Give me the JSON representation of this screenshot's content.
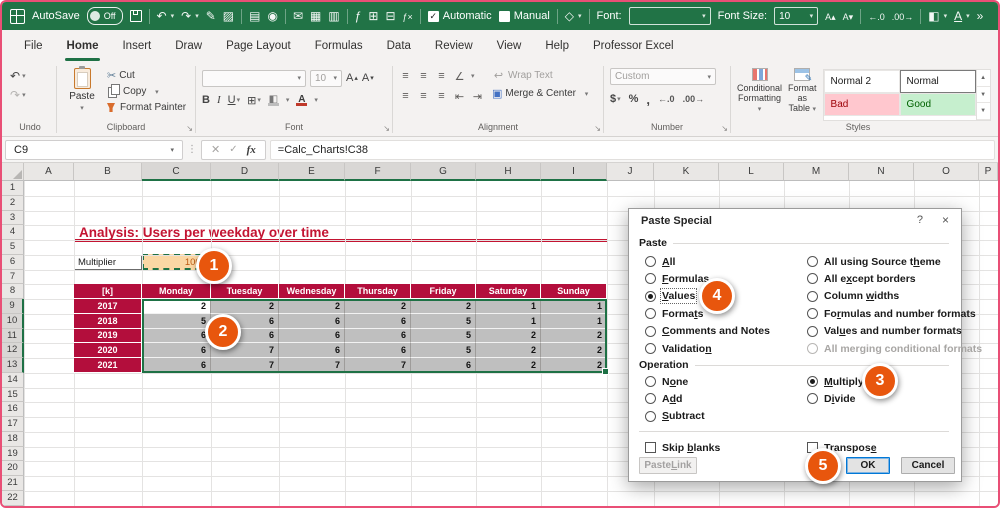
{
  "titlebar": {
    "autosave_label": "AutoSave",
    "autosave_state": "Off",
    "calc_automatic": "Automatic",
    "calc_manual": "Manual",
    "font_label": "Font:",
    "font_size_label": "Font Size:",
    "font_size_value": "10"
  },
  "tabs": [
    {
      "label": "File"
    },
    {
      "label": "Home",
      "active": true
    },
    {
      "label": "Insert"
    },
    {
      "label": "Draw"
    },
    {
      "label": "Page Layout"
    },
    {
      "label": "Formulas"
    },
    {
      "label": "Data"
    },
    {
      "label": "Review"
    },
    {
      "label": "View"
    },
    {
      "label": "Help"
    },
    {
      "label": "Professor Excel"
    }
  ],
  "ribbon": {
    "undo_label": "Undo",
    "clipboard": {
      "label": "Clipboard",
      "paste": "Paste",
      "cut": "Cut",
      "copy": "Copy",
      "format_painter": "Format Painter"
    },
    "font": {
      "label": "Font",
      "size": "10",
      "bold": "B",
      "italic": "I",
      "underline": "U"
    },
    "alignment": {
      "label": "Alignment",
      "wrap": "Wrap Text",
      "merge": "Merge & Center"
    },
    "number": {
      "label": "Number",
      "format": "Custom",
      "dollar": "$",
      "percent": "%",
      "comma": ","
    },
    "styles": {
      "label": "Styles",
      "cf_line1": "Conditional",
      "cf_line2": "Formatting",
      "fat_line1": "Format as",
      "fat_line2": "Table",
      "gallery": [
        {
          "name": "Normal 2",
          "bg": "#FFFFFF",
          "fg": "#1a1a1a"
        },
        {
          "name": "Normal",
          "bg": "#FFFFFF",
          "fg": "#1a1a1a",
          "selected": true
        },
        {
          "name": "Bad",
          "bg": "#FFC7CE",
          "fg": "#9C0006"
        },
        {
          "name": "Good",
          "bg": "#C6EFCE",
          "fg": "#006100"
        }
      ]
    }
  },
  "formula_bar": {
    "cell_ref": "C9",
    "formula": "=Calc_Charts!C38"
  },
  "sheet": {
    "columns": [
      "A",
      "B",
      "C",
      "D",
      "E",
      "F",
      "G",
      "H",
      "I",
      "J",
      "K",
      "L",
      "M",
      "N",
      "O",
      "P"
    ],
    "selected_columns": [
      "C",
      "D",
      "E",
      "F",
      "G",
      "H",
      "I"
    ],
    "row_count": 22,
    "selected_rows": [
      9,
      10,
      11,
      12,
      13
    ],
    "title": "Analysis: Users per weekday over time",
    "multiplier_label": "Multiplier",
    "multiplier_value": "1000",
    "table": {
      "corner": "[k]",
      "days": [
        "Monday",
        "Tuesday",
        "Wednesday",
        "Thursday",
        "Friday",
        "Saturday",
        "Sunday"
      ],
      "rows": [
        {
          "year": "2017",
          "values": [
            2,
            2,
            2,
            2,
            2,
            1,
            1
          ]
        },
        {
          "year": "2018",
          "values": [
            5,
            6,
            6,
            6,
            5,
            1,
            1
          ]
        },
        {
          "year": "2019",
          "values": [
            6,
            6,
            6,
            6,
            5,
            2,
            2
          ]
        },
        {
          "year": "2020",
          "values": [
            6,
            7,
            6,
            6,
            5,
            2,
            2
          ]
        },
        {
          "year": "2021",
          "values": [
            6,
            7,
            7,
            7,
            6,
            2,
            2
          ]
        }
      ]
    }
  },
  "dialog": {
    "title": "Paste Special",
    "help": "?",
    "close": "×",
    "paste_label": "Paste",
    "paste_options": [
      {
        "pre": "",
        "u": "A",
        "post": "ll",
        "col": 0
      },
      {
        "pre": "",
        "u": "F",
        "post": "ormulas",
        "col": 0
      },
      {
        "pre": "",
        "u": "V",
        "post": "alues",
        "col": 0,
        "selected": true,
        "focus": true
      },
      {
        "pre": "Forma",
        "u": "t",
        "post": "s",
        "col": 0
      },
      {
        "pre": "",
        "u": "C",
        "post": "omments and Notes",
        "col": 0
      },
      {
        "pre": "Validatio",
        "u": "n",
        "post": "",
        "col": 0
      },
      {
        "pre": "All using Source t",
        "u": "h",
        "post": "eme",
        "col": 1
      },
      {
        "pre": "All e",
        "u": "x",
        "post": "cept borders",
        "col": 1
      },
      {
        "pre": "Column ",
        "u": "w",
        "post": "idths",
        "col": 1
      },
      {
        "pre": "Fo",
        "u": "r",
        "post": "mulas and number formats",
        "col": 1
      },
      {
        "pre": "Val",
        "u": "u",
        "post": "es and number formats",
        "col": 1
      },
      {
        "pre": "All mergin",
        "u": "g",
        "post": " conditional formats",
        "col": 1,
        "disabled": true
      }
    ],
    "operation_label": "Operation",
    "operation_options": [
      {
        "pre": "N",
        "u": "o",
        "post": "ne",
        "col": 0
      },
      {
        "pre": "A",
        "u": "d",
        "post": "d",
        "col": 0
      },
      {
        "pre": "",
        "u": "S",
        "post": "ubtract",
        "col": 0
      },
      {
        "pre": "",
        "u": "M",
        "post": "ultiply",
        "col": 1,
        "selected": true
      },
      {
        "pre": "D",
        "u": "i",
        "post": "vide",
        "col": 1
      }
    ],
    "skip_blanks": {
      "pre": "Skip ",
      "u": "b",
      "post": "lanks"
    },
    "transpose": {
      "pre": "Transpos",
      "u": "e",
      "post": ""
    },
    "paste_link": {
      "pre": "Paste ",
      "u": "L",
      "post": "ink"
    },
    "ok": "OK",
    "cancel": "Cancel"
  },
  "badges": [
    "1",
    "2",
    "3",
    "4",
    "5"
  ],
  "colors": {
    "excel_green": "#217346",
    "selection_green": "#1E7145",
    "table_crimson": "#B30E3C",
    "title_red": "#C31432",
    "badge_orange": "#E8560D",
    "copied_cell_peach": "#FBD7A4",
    "data_cell_gray": "#BFBFBF",
    "good_bg": "#C6EFCE",
    "good_fg": "#006100",
    "bad_bg": "#FFC7CE",
    "bad_fg": "#9C0006",
    "window_border_pink": "#E94F76"
  }
}
